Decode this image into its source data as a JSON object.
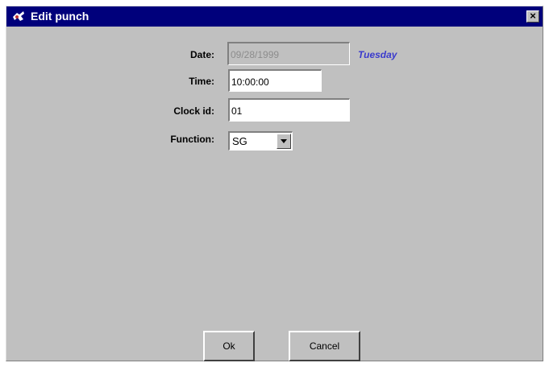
{
  "window": {
    "title": "Edit punch",
    "close_glyph": "×"
  },
  "form": {
    "date": {
      "label": "Date:",
      "value": "09/28/1999",
      "enabled": false,
      "weekday": "Tuesday"
    },
    "time": {
      "label": "Time:",
      "value": "10:00:00"
    },
    "clock_id": {
      "label": "Clock id:",
      "value": "01"
    },
    "function": {
      "label": "Function:",
      "selected": "SG"
    }
  },
  "buttons": {
    "ok": "Ok",
    "cancel": "Cancel"
  },
  "colors": {
    "titlebar": "#00007b",
    "window_bg": "#c0c0c0",
    "weekday_text": "#3a3acd"
  },
  "icons": {
    "title_icon": "app-icon",
    "close_icon": "close-icon",
    "dropdown_icon": "chevron-down-icon"
  }
}
